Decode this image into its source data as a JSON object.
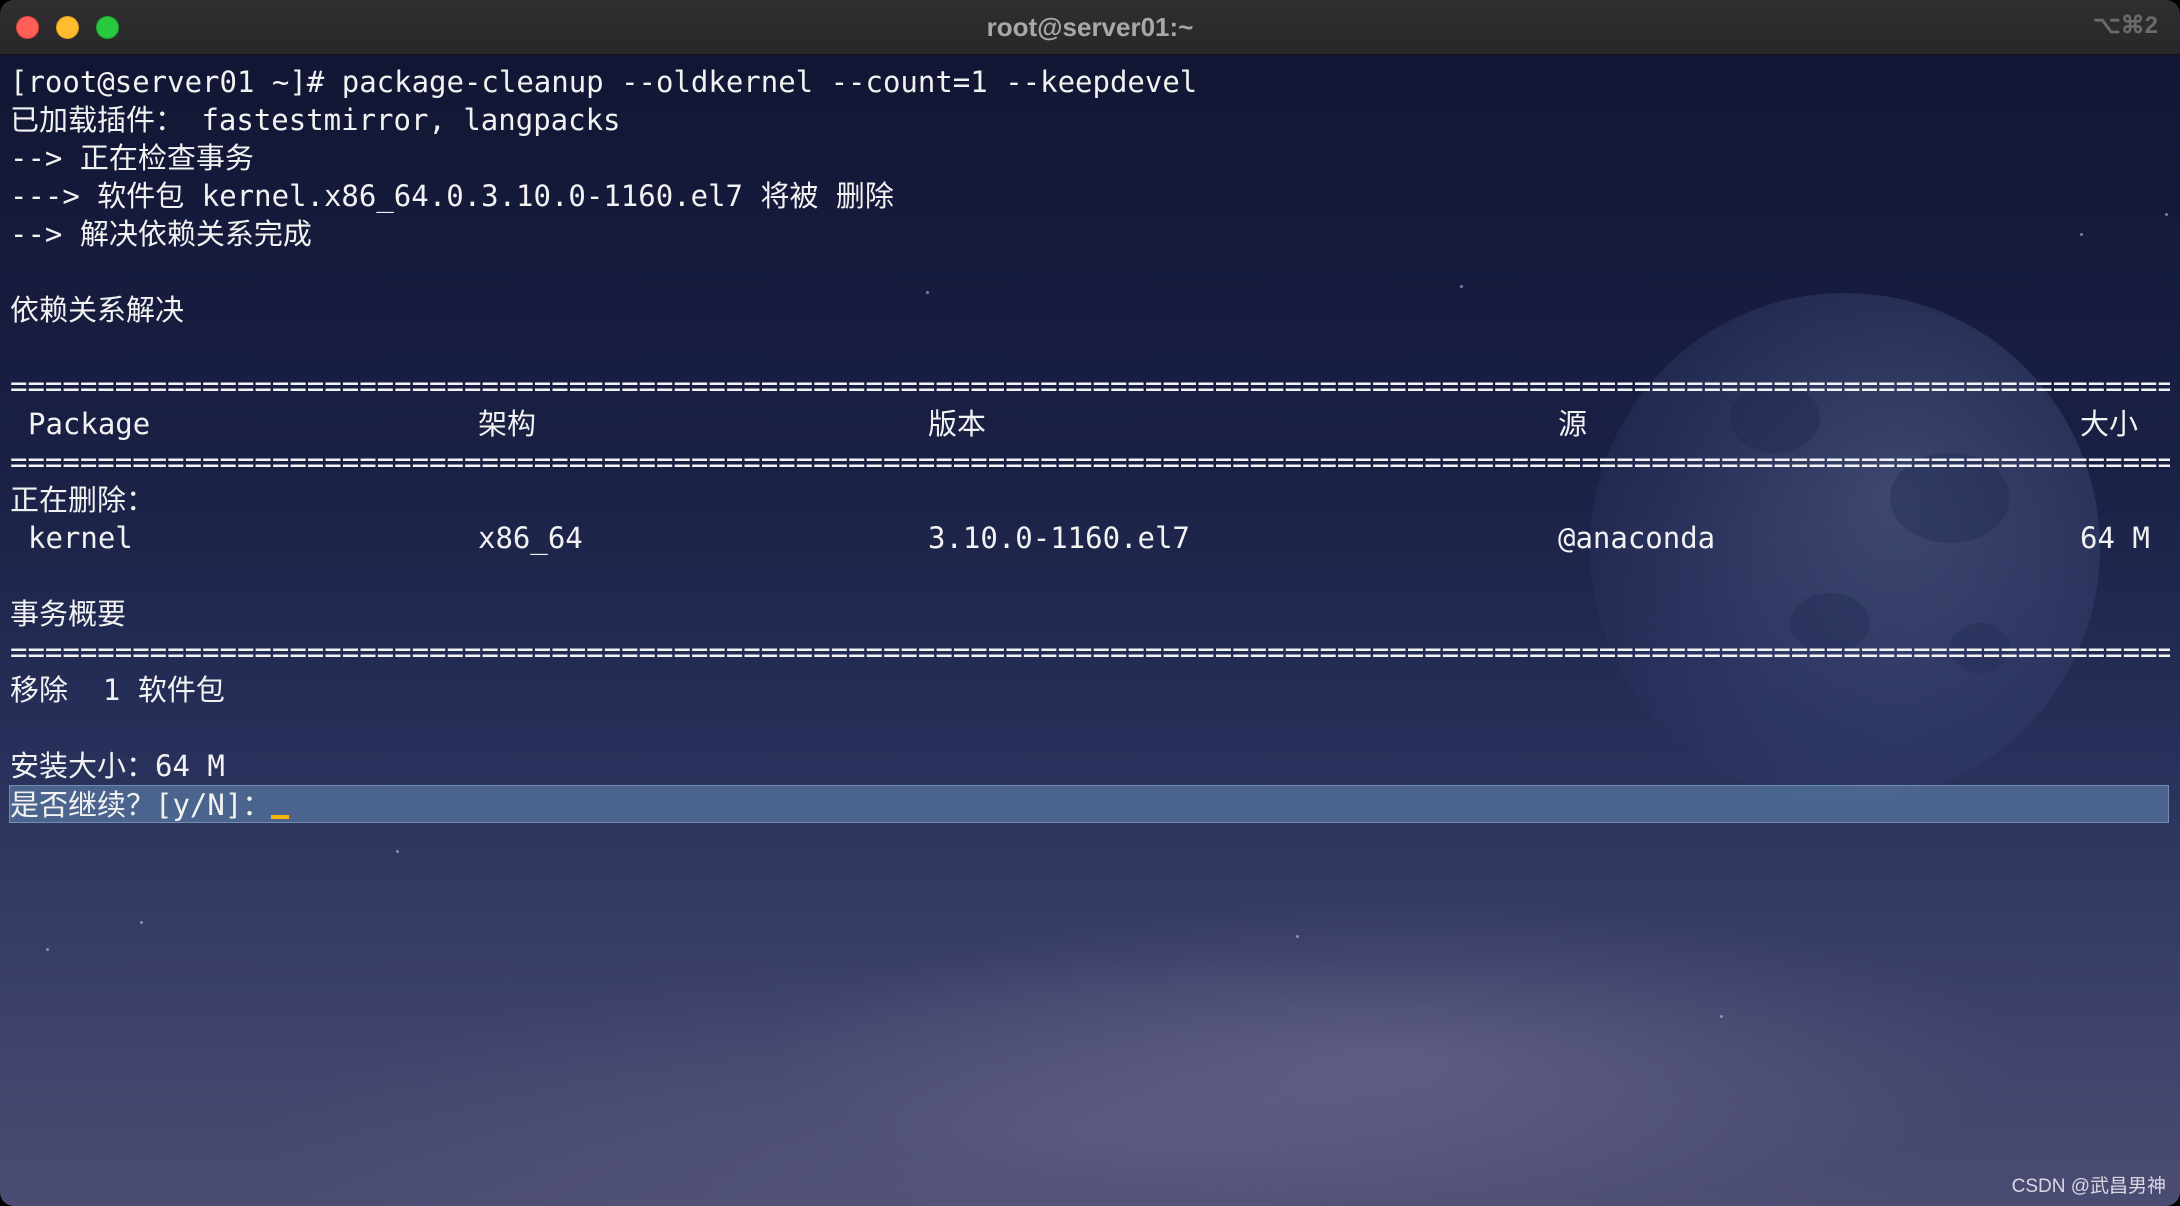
{
  "window": {
    "title": "root@server01:~",
    "shortcut": "⌥⌘2"
  },
  "terminal": {
    "prompt_line": "[root@server01 ~]# package-cleanup --oldkernel --count=1 --keepdevel",
    "lines_before_table": [
      "已加载插件： fastestmirror, langpacks",
      "--> 正在检查事务",
      "---> 软件包 kernel.x86_64.0.3.10.0-1160.el7 将被 删除",
      "--> 解决依赖关系完成",
      "",
      "依赖关系解决",
      ""
    ],
    "separator": "================================================================================================================================================================",
    "table": {
      "headers": [
        "Package",
        "架构",
        "版本",
        "源",
        "大小"
      ],
      "section_label": "正在删除：",
      "rows": [
        [
          "kernel",
          "x86_64",
          "3.10.0-1160.el7",
          "@anaconda",
          "64 M"
        ]
      ]
    },
    "summary_title": "事务概要",
    "summary_line": "移除  1 软件包",
    "install_size": "安装大小：64 M",
    "confirm_prompt": "是否继续？[y/N]："
  },
  "watermark": "CSDN @武昌男神",
  "colors": {
    "traffic_close": "#fe5f57",
    "traffic_minimize": "#febc2e",
    "traffic_maximize": "#28c840",
    "cursor": "#f5b400",
    "text": "#f2f2f2"
  }
}
